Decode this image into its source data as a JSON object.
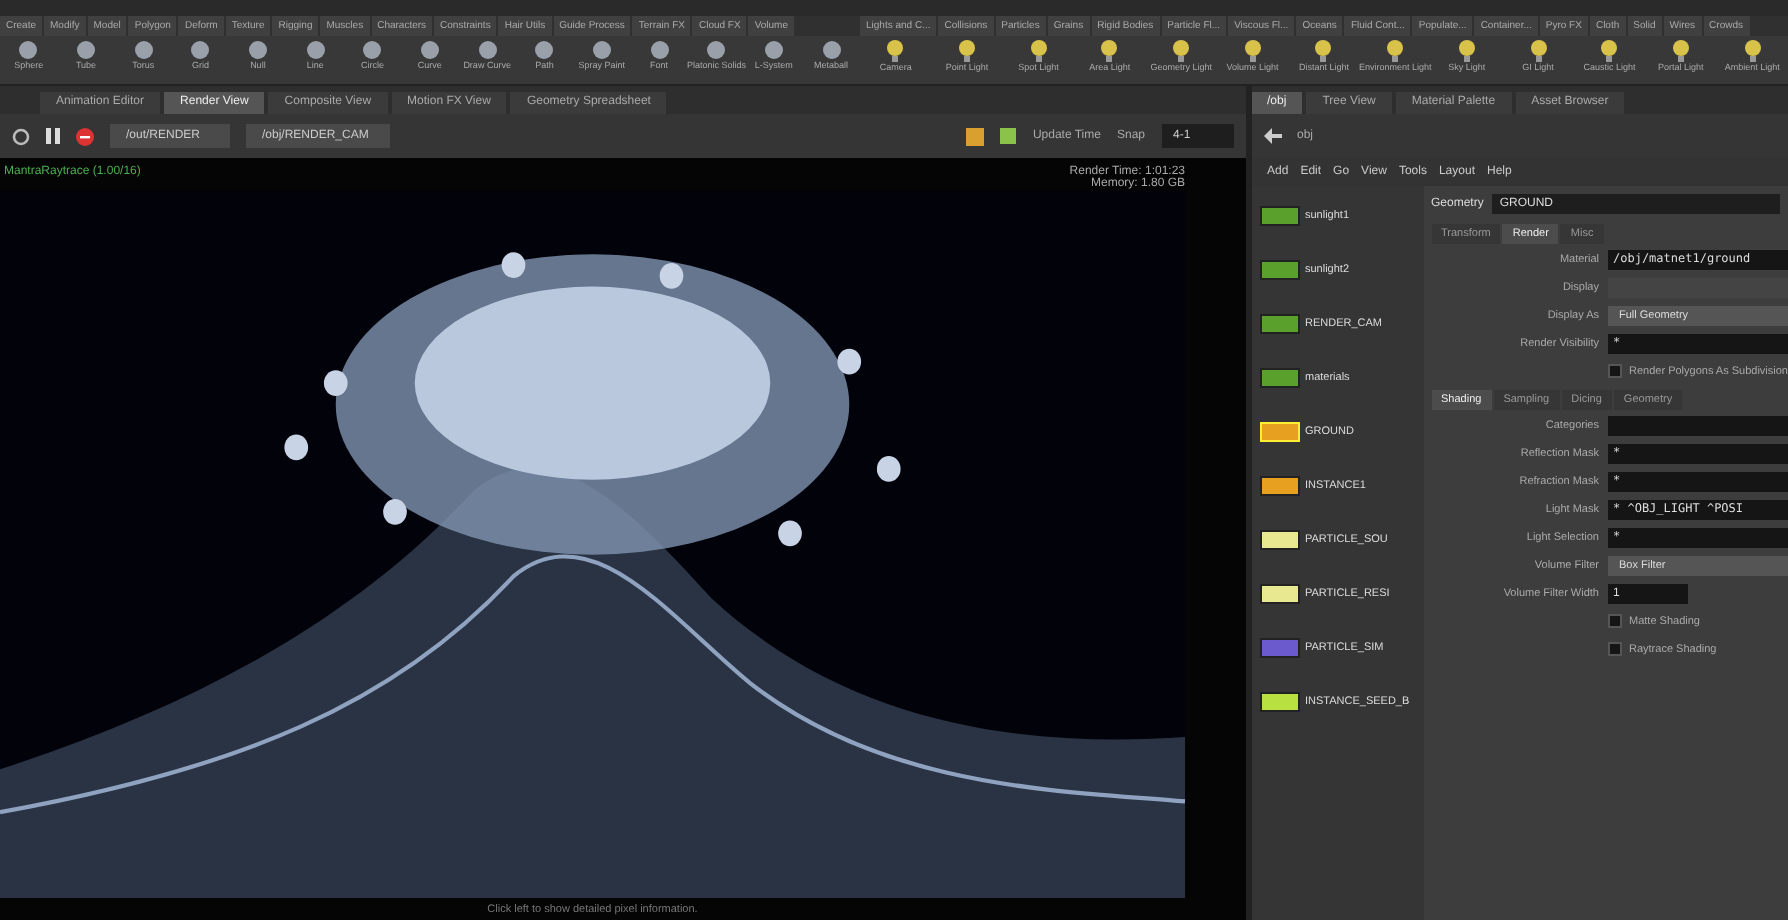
{
  "shelf_tabs_left": [
    "Create",
    "Modify",
    "Model",
    "Polygon",
    "Deform",
    "Texture",
    "Rigging",
    "Muscles",
    "Characters",
    "Constraints",
    "Hair Utils",
    "Guide Process",
    "Terrain FX",
    "Cloud FX",
    "Volume"
  ],
  "shelf_tabs_right": [
    "Lights and C...",
    "Collisions",
    "Particles",
    "Grains",
    "Rigid Bodies",
    "Particle Fl...",
    "Viscous Fl...",
    "Oceans",
    "Fluid Cont...",
    "Populate...",
    "Container...",
    "Pyro FX",
    "Cloth",
    "Solid",
    "Wires",
    "Crowds"
  ],
  "shelf_tools_left": [
    "Sphere",
    "Tube",
    "Torus",
    "Grid",
    "Null",
    "Line",
    "Circle",
    "Curve",
    "Draw Curve",
    "Path",
    "Spray Paint",
    "Font",
    "Platonic Solids",
    "L-System",
    "Metaball"
  ],
  "shelf_tools_right": [
    "Camera",
    "Point Light",
    "Spot Light",
    "Area Light",
    "Geometry Light",
    "Volume Light",
    "Distant Light",
    "Environment Light",
    "Sky Light",
    "GI Light",
    "Caustic Light",
    "Portal Light",
    "Ambient Light"
  ],
  "pane_tabs": [
    {
      "label": "Animation Editor",
      "selected": false
    },
    {
      "label": "Render View",
      "selected": true
    },
    {
      "label": "Composite View",
      "selected": false
    },
    {
      "label": "Motion FX View",
      "selected": false
    },
    {
      "label": "Geometry Spreadsheet",
      "selected": false
    }
  ],
  "viewer_toolbar": {
    "render_node": "/out/RENDER",
    "camera": "/obj/RENDER_CAM",
    "update_mode": "Update Time",
    "snap_label": "Snap",
    "snap_value": "4-1"
  },
  "render": {
    "status": "MantraRaytrace (1.00/16)",
    "render_time": "Render Time: 1:01:23",
    "memory": "Memory: 1.80 GB",
    "hint": "Click left to show detailed pixel information."
  },
  "right_tabs": [
    {
      "label": "/obj",
      "selected": true
    },
    {
      "label": "Tree View",
      "selected": false
    },
    {
      "label": "Material Palette",
      "selected": false
    },
    {
      "label": "Asset Browser",
      "selected": false
    }
  ],
  "network_path": "obj",
  "network_menu": [
    "Add",
    "Edit",
    "Go",
    "View",
    "Tools",
    "Layout",
    "Help"
  ],
  "nodes": [
    {
      "name": "sunlight1",
      "color": "#5aa02c",
      "selected": false
    },
    {
      "name": "sunlight2",
      "color": "#5aa02c",
      "selected": false
    },
    {
      "name": "RENDER_CAM",
      "color": "#5aa02c",
      "selected": false
    },
    {
      "name": "materials",
      "color": "#5aa02c",
      "selected": false
    },
    {
      "name": "GROUND",
      "color": "#e8a020",
      "selected": true
    },
    {
      "name": "INSTANCE1",
      "color": "#e8a020",
      "selected": false
    },
    {
      "name": "PARTICLE_SOU",
      "color": "#e8e890",
      "selected": false
    },
    {
      "name": "PARTICLE_RESI",
      "color": "#e8e890",
      "selected": false
    },
    {
      "name": "PARTICLE_SIM",
      "color": "#6a5acd",
      "selected": false
    },
    {
      "name": "INSTANCE_SEED_B",
      "color": "#b8e040",
      "selected": false
    }
  ],
  "params": {
    "type": "Geometry",
    "node": "GROUND",
    "tabs": [
      {
        "label": "Transform",
        "selected": false
      },
      {
        "label": "Render",
        "selected": true
      },
      {
        "label": "Misc",
        "selected": false
      }
    ],
    "top_rows": [
      {
        "kind": "field",
        "label": "Material",
        "value": "/obj/matnet1/ground"
      },
      {
        "kind": "field",
        "label": "Display",
        "value": "",
        "disabled": true
      },
      {
        "kind": "menu",
        "label": "Display As",
        "value": "Full Geometry"
      },
      {
        "kind": "field",
        "label": "Render Visibility",
        "value": "*"
      },
      {
        "kind": "check",
        "label": "Render Polygons As Subdivision",
        "checked": false
      }
    ],
    "subtabs": [
      {
        "label": "Shading",
        "selected": true
      },
      {
        "label": "Sampling",
        "selected": false
      },
      {
        "label": "Dicing",
        "selected": false
      },
      {
        "label": "Geometry",
        "selected": false
      }
    ],
    "rows": [
      {
        "kind": "field",
        "label": "Categories",
        "value": ""
      },
      {
        "kind": "field",
        "label": "Reflection Mask",
        "value": "*"
      },
      {
        "kind": "field",
        "label": "Refraction Mask",
        "value": "*"
      },
      {
        "kind": "field",
        "label": "Light Mask",
        "value": "* ^OBJ_LIGHT ^POSI"
      },
      {
        "kind": "field",
        "label": "Light Selection",
        "value": "*"
      },
      {
        "kind": "menu",
        "label": "Volume Filter",
        "value": "Box Filter"
      },
      {
        "kind": "number",
        "label": "Volume Filter Width",
        "value": "1"
      },
      {
        "kind": "check",
        "label": "Matte Shading",
        "checked": false
      },
      {
        "kind": "check",
        "label": "Raytrace Shading",
        "checked": false
      }
    ]
  }
}
